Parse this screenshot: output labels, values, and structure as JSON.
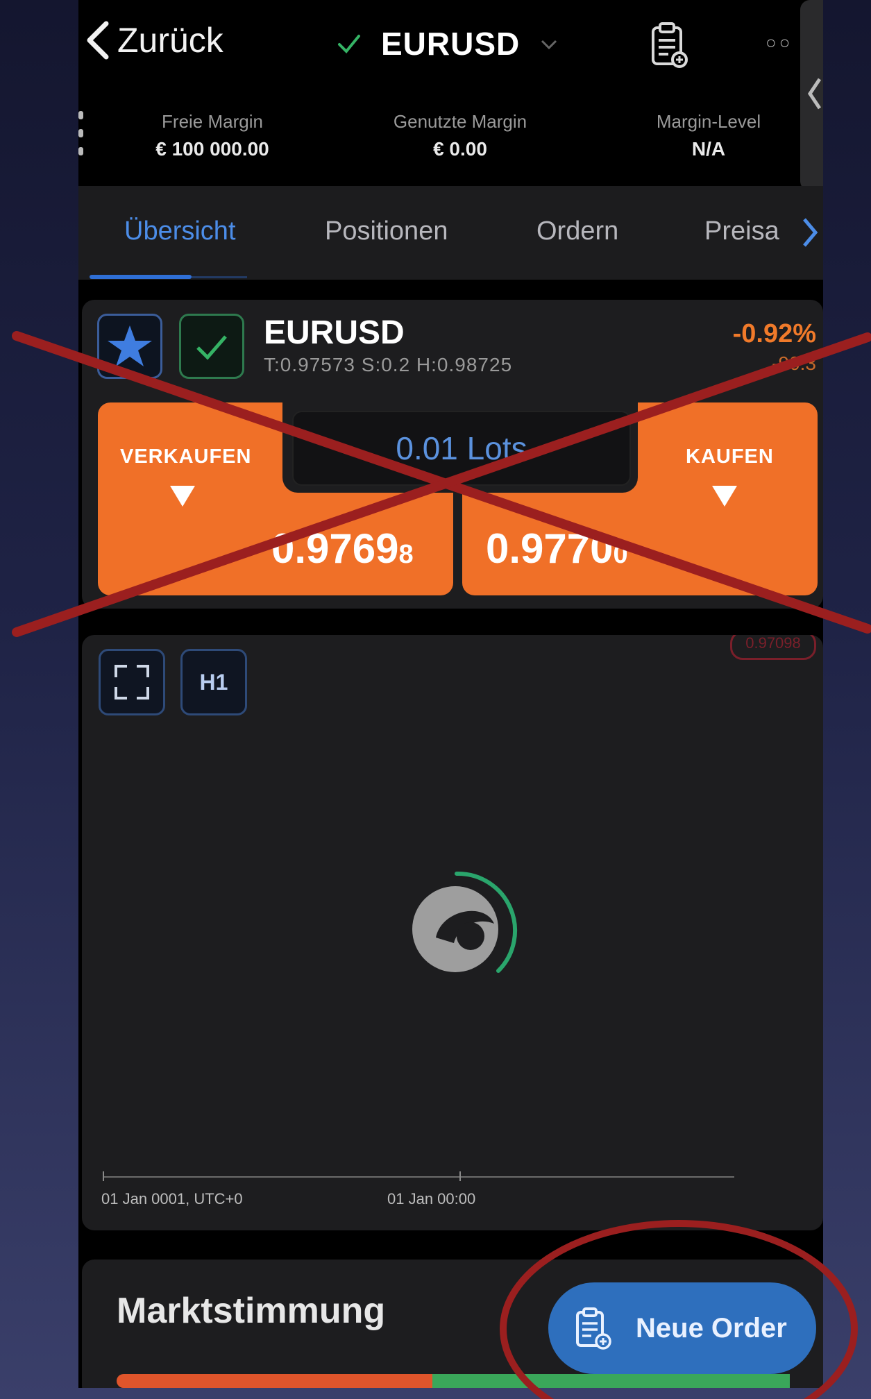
{
  "header": {
    "back_label": "Zurück",
    "symbol": "EURUSD"
  },
  "margins": [
    {
      "label": "Freie Margin",
      "value": "€ 100 000.00"
    },
    {
      "label": "Genutzte Margin",
      "value": "€ 0.00"
    },
    {
      "label": "Margin-Level",
      "value": "N/A"
    }
  ],
  "tabs": [
    {
      "label": "Übersicht",
      "active": true
    },
    {
      "label": "Positionen"
    },
    {
      "label": "Ordern"
    },
    {
      "label": "Preisa"
    }
  ],
  "instrument": {
    "name": "EURUSD",
    "stats": "T:0.97573  S:0.2  H:0.98725",
    "change_pct": "-0.92%",
    "change_abs": "-90.3",
    "sell_label": "VERKAUFEN",
    "buy_label": "KAUFEN",
    "sell_price_main": "0.9769",
    "sell_price_small": "8",
    "buy_price_main": "0.9770",
    "buy_price_small": "0",
    "lots": "0.01 Lots",
    "colors": {
      "accent": "#f07028",
      "positive": "#3aa75a",
      "link": "#4c8de8"
    }
  },
  "chart": {
    "timeframe": "H1",
    "price_pill": "0.97098",
    "axis_left": "01 Jan 0001, UTC+0",
    "axis_mid": "01 Jan 00:00"
  },
  "sentiment": {
    "title": "Marktstimmung"
  },
  "fab": {
    "label": "Neue Order"
  },
  "annotations": {
    "cross_color": "#9b1f1f",
    "circle_color": "#9b1f1f"
  }
}
